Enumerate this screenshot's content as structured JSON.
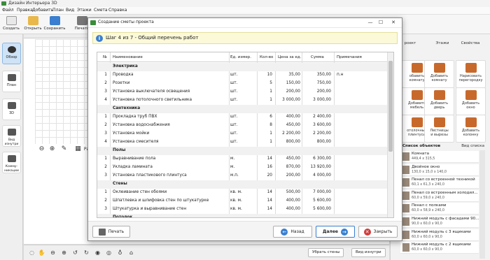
{
  "app": {
    "title": "Дизайн Интерьера 3D"
  },
  "menu": [
    "Файл",
    "Правка",
    "Добавить",
    "План",
    "Вид",
    "Этажи",
    "Смета",
    "Справка"
  ],
  "toolbar": [
    "Создать",
    "Открыть",
    "Сохранить",
    "Печать"
  ],
  "left_nav": [
    "Обзор",
    "План",
    "3D",
    "Вид изнутри",
    "Комму-\nникации"
  ],
  "canvas_tools": {
    "pan_label": "Ра"
  },
  "bottom_buttons": {
    "hide_walls": "Убрать стены",
    "inside_view": "Вид изнутри"
  },
  "right_panel": {
    "tabs": [
      "роект",
      "Этажи",
      "Свойства"
    ],
    "tiles": [
      "обавить\nкомнату",
      "Добавить\nкомнату",
      "Нарисовать\nперегородку",
      "Добавить\nмебель",
      "Добавить\nдверь",
      "Добавить\nокно",
      "отолочные\nплинтусы",
      "Лестницы\nи вырезы",
      "Добавить\nколонну"
    ],
    "objects_title": "Список объектов",
    "objects_view": "Вид списка",
    "objects": [
      {
        "name": "Комната",
        "size": "449,4 x 315,5"
      },
      {
        "name": "Двойное окно",
        "size": "130,0 x 15,0 x 140,0"
      },
      {
        "name": "Пенал со встроенной техникой",
        "size": "60,1 x 61,3 x 240,0"
      },
      {
        "name": "Пенал со встроенным холодил...",
        "size": "60,0 x 59,0 x 240,0"
      },
      {
        "name": "Пенал с полками",
        "size": "60,0 x 58,9 x 240,0"
      },
      {
        "name": "Нижний модуль с фасадами 90...",
        "size": "90,0 x 60,0 x 90,0"
      },
      {
        "name": "Нижний модуль с 3 ящиками",
        "size": "60,0 x 60,0 x 90,0"
      },
      {
        "name": "Нижний модуль с 2 ящиками",
        "size": "60,0 x 60,0 x 90,0"
      }
    ]
  },
  "dialog": {
    "title": "Создание сметы проекта",
    "step": "Шаг 4 из 7 - Общий перечень работ",
    "columns": [
      "№",
      "Наименование",
      "Ед. измер.",
      "Кол-во",
      "Цена за ед.",
      "Сумма",
      "Примечания"
    ],
    "rows": [
      {
        "group": "Электрика"
      },
      {
        "n": "1",
        "name": "Проводка",
        "unit": "шт.",
        "qty": "10",
        "price": "35,00",
        "sum": "350,00",
        "note": "п.н"
      },
      {
        "n": "2",
        "name": "Розетки",
        "unit": "шт.",
        "qty": "5",
        "price": "150,00",
        "sum": "750,00",
        "note": ""
      },
      {
        "n": "3",
        "name": "Установка выключателя освещения",
        "unit": "шт.",
        "qty": "1",
        "price": "200,00",
        "sum": "200,00",
        "note": ""
      },
      {
        "n": "4",
        "name": "Установка потолочного светильника",
        "unit": "шт.",
        "qty": "1",
        "price": "3 000,00",
        "sum": "3 000,00",
        "note": ""
      },
      {
        "group": "Сантехника"
      },
      {
        "n": "1",
        "name": "Прокладка труб ПВХ",
        "unit": "шт.",
        "qty": "6",
        "price": "400,00",
        "sum": "2 400,00",
        "note": ""
      },
      {
        "n": "2",
        "name": "Установка водоснабжения",
        "unit": "шт.",
        "qty": "8",
        "price": "450,00",
        "sum": "3 600,00",
        "note": ""
      },
      {
        "n": "3",
        "name": "Установка мойки",
        "unit": "шт.",
        "qty": "1",
        "price": "2 200,00",
        "sum": "2 200,00",
        "note": ""
      },
      {
        "n": "4",
        "name": "Установка смесителя",
        "unit": "шт.",
        "qty": "1",
        "price": "800,00",
        "sum": "800,00",
        "note": ""
      },
      {
        "group": "Полы"
      },
      {
        "n": "1",
        "name": "Выравнивание пола",
        "unit": "м.",
        "qty": "14",
        "price": "450,00",
        "sum": "6 300,00",
        "note": ""
      },
      {
        "n": "2",
        "name": "Укладка ламината",
        "unit": "м.",
        "qty": "16",
        "price": "870,00",
        "sum": "13 920,00",
        "note": ""
      },
      {
        "n": "3",
        "name": "Установка пластикового плинтуса",
        "unit": "м.п.",
        "qty": "20",
        "price": "200,00",
        "sum": "4 000,00",
        "note": ""
      },
      {
        "group": "Стены"
      },
      {
        "n": "1",
        "name": "Оклеивание стен обоями",
        "unit": "кв. м.",
        "qty": "14",
        "price": "500,00",
        "sum": "7 000,00",
        "note": ""
      },
      {
        "n": "2",
        "name": "Шпатлевка и шлифовка стен по штукатурке",
        "unit": "кв. м.",
        "qty": "14",
        "price": "400,00",
        "sum": "5 600,00",
        "note": ""
      },
      {
        "n": "3",
        "name": "Штукатурка и выравнивание стен",
        "unit": "кв. м.",
        "qty": "14",
        "price": "400,00",
        "sum": "5 600,00",
        "note": ""
      },
      {
        "group": "Потолок"
      }
    ],
    "buttons": {
      "print": "Печать",
      "back": "Назад",
      "next": "Далее",
      "close": "Закрыть"
    }
  },
  "colors": {
    "accent": "#3a7fd0",
    "step_bg": "#fbf9d8",
    "close_red": "#d33b3b"
  }
}
